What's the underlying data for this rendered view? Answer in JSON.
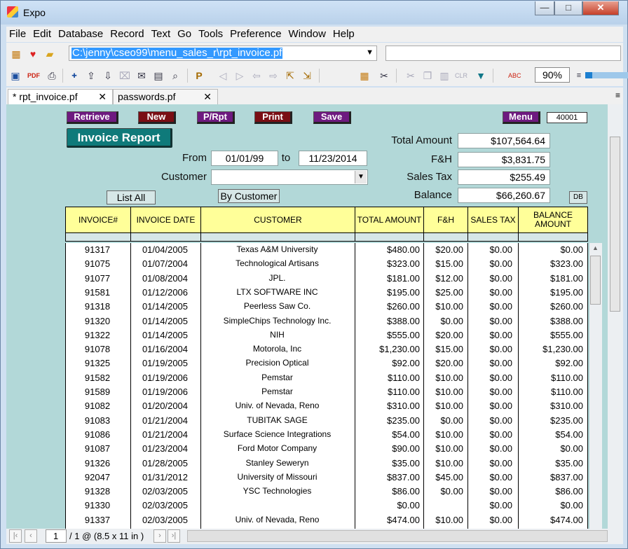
{
  "window": {
    "title": "Expo",
    "minimize": "—",
    "maximize": "□",
    "close": "✕"
  },
  "menu": [
    "File",
    "Edit",
    "Database",
    "Record",
    "Text",
    "Go",
    "Tools",
    "Preference",
    "Window",
    "Help"
  ],
  "path": {
    "value": "C:\\jenny\\cseo99\\menu_sales_r\\rpt_invoice.pf",
    "secondary": ""
  },
  "toolbar": {
    "zoom": "90%"
  },
  "tabs": [
    {
      "label": "* rpt_invoice.pf",
      "close": "✕"
    },
    {
      "label": "passwords.pf",
      "close": "✕"
    }
  ],
  "form": {
    "buttons": {
      "retrieve": "Retrieve",
      "new": "New",
      "prpt": "P/Rpt",
      "print": "Print",
      "save": "Save",
      "menu": "Menu"
    },
    "record_id": "40001",
    "report_title": "Invoice Report",
    "from_label": "From",
    "from_value": "01/01/99",
    "to_label": "to",
    "to_value": "11/23/2014",
    "customer_label": "Customer",
    "customer_value": "",
    "list_all": "List  All",
    "by_customer": "By Customer",
    "totals": {
      "total_amount_label": "Total Amount",
      "total_amount": "$107,564.64",
      "fh_label": "F&H",
      "fh": "$3,831.75",
      "sales_tax_label": "Sales Tax",
      "sales_tax": "$255.49",
      "balance_label": "Balance",
      "balance": "$66,260.67"
    },
    "db_label": "DB"
  },
  "table": {
    "headers": [
      "INVOICE#",
      "INVOICE DATE",
      "CUSTOMER",
      "TOTAL AMOUNT",
      "F&H",
      "SALES TAX",
      "BALANCE AMOUNT"
    ],
    "rows": [
      [
        "91317",
        "01/04/2005",
        "Texas A&M University",
        "$480.00",
        "$20.00",
        "$0.00",
        "$0.00"
      ],
      [
        "91075",
        "01/07/2004",
        "Technological Artisans",
        "$323.00",
        "$15.00",
        "$0.00",
        "$323.00"
      ],
      [
        "91077",
        "01/08/2004",
        "JPL.",
        "$181.00",
        "$12.00",
        "$0.00",
        "$181.00"
      ],
      [
        "91581",
        "01/12/2006",
        "LTX SOFTWARE INC",
        "$195.00",
        "$25.00",
        "$0.00",
        "$195.00"
      ],
      [
        "91318",
        "01/14/2005",
        "Peerless Saw Co.",
        "$260.00",
        "$10.00",
        "$0.00",
        "$260.00"
      ],
      [
        "91320",
        "01/14/2005",
        "SimpleChips Technology Inc.",
        "$388.00",
        "$0.00",
        "$0.00",
        "$388.00"
      ],
      [
        "91322",
        "01/14/2005",
        "NIH",
        "$555.00",
        "$20.00",
        "$0.00",
        "$555.00"
      ],
      [
        "91078",
        "01/16/2004",
        "Motorola, Inc",
        "$1,230.00",
        "$15.00",
        "$0.00",
        "$1,230.00"
      ],
      [
        "91325",
        "01/19/2005",
        "Precision Optical",
        "$92.00",
        "$20.00",
        "$0.00",
        "$92.00"
      ],
      [
        "91582",
        "01/19/2006",
        "Pemstar",
        "$110.00",
        "$10.00",
        "$0.00",
        "$110.00"
      ],
      [
        "91589",
        "01/19/2006",
        "Pemstar",
        "$110.00",
        "$10.00",
        "$0.00",
        "$110.00"
      ],
      [
        "91082",
        "01/20/2004",
        "Univ. of Nevada, Reno",
        "$310.00",
        "$10.00",
        "$0.00",
        "$310.00"
      ],
      [
        "91083",
        "01/21/2004",
        "TUBITAK SAGE",
        "$235.00",
        "$0.00",
        "$0.00",
        "$235.00"
      ],
      [
        "91086",
        "01/21/2004",
        "Surface Science Integrations",
        "$54.00",
        "$10.00",
        "$0.00",
        "$54.00"
      ],
      [
        "91087",
        "01/23/2004",
        "Ford Motor Company",
        "$90.00",
        "$10.00",
        "$0.00",
        "$0.00"
      ],
      [
        "91326",
        "01/28/2005",
        "Stanley Seweryn",
        "$35.00",
        "$10.00",
        "$0.00",
        "$35.00"
      ],
      [
        "92047",
        "01/31/2012",
        "University of Missouri",
        "$837.00",
        "$45.00",
        "$0.00",
        "$837.00"
      ],
      [
        "91328",
        "02/03/2005",
        "YSC Technologies",
        "$86.00",
        "$0.00",
        "$0.00",
        "$86.00"
      ],
      [
        "91330",
        "02/03/2005",
        "",
        "$0.00",
        "",
        "$0.00",
        "$0.00"
      ],
      [
        "91337",
        "02/03/2005",
        "Univ. of Nevada, Reno",
        "$474.00",
        "$10.00",
        "$0.00",
        "$474.00"
      ]
    ]
  },
  "pager": {
    "page": "1",
    "info": "/ 1 @ (8.5 x 11 in )"
  }
}
